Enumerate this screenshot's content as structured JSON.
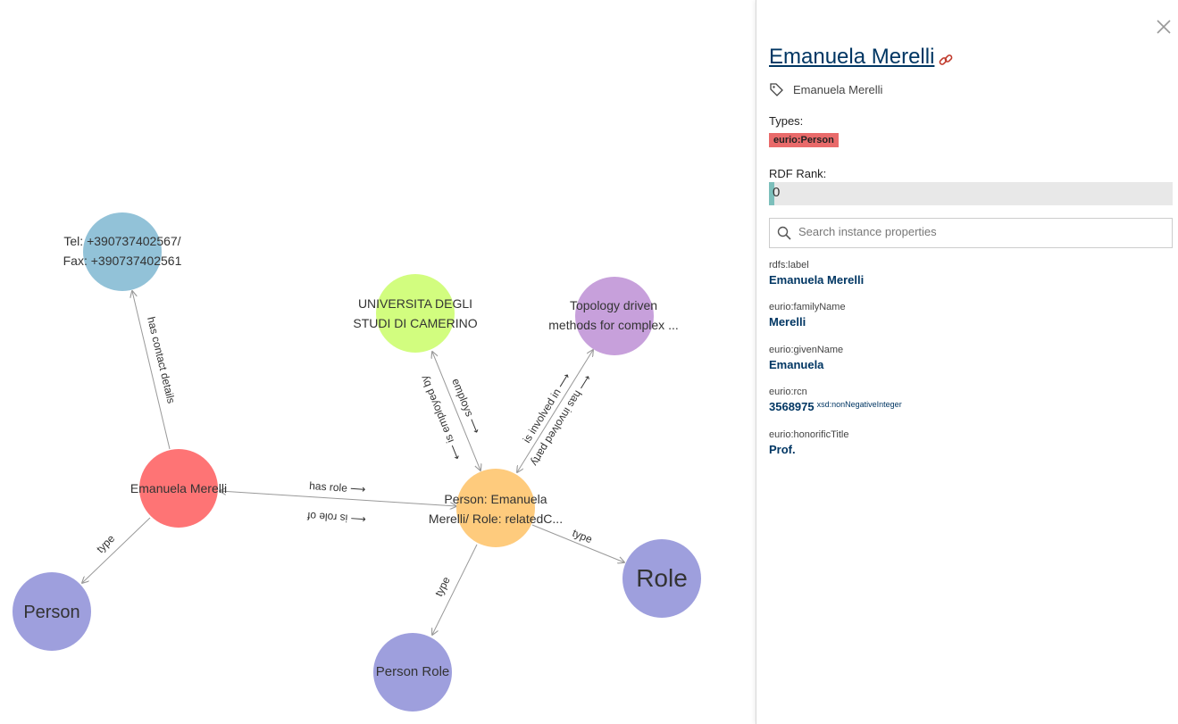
{
  "graph": {
    "nodes": {
      "contact": [
        "Tel: +390737402567/",
        "Fax: +390737402561"
      ],
      "university": [
        "UNIVERSITA DEGLI",
        "STUDI DI CAMERINO"
      ],
      "project": [
        "Topology driven",
        "methods for complex ..."
      ],
      "merelli": "Emanuela Merelli",
      "person_role_node": [
        "Person: Emanuela",
        "Merelli/ Role: relatedC..."
      ],
      "person_class": "Person",
      "person_role_class": "Person Role",
      "role_class": "Role"
    },
    "edges": {
      "has_contact_details": "has contact details",
      "employs": "employs ⟶",
      "is_employed_by": "⟵ is employed by",
      "is_involved_in": "is involved in ⟶",
      "has_involved_party": "⟵ has involved party",
      "has_role": "has role ⟶",
      "is_role_of": "⟵ is role of",
      "type": "type"
    },
    "colors": {
      "contact": "#92c2d8",
      "university": "#d2fd7f",
      "project": "#c7a0db",
      "merelli": "#fe7475",
      "person_role_node": "#fecb7d",
      "class": "#9e9fdd"
    }
  },
  "panel": {
    "collapse_glyph": "‹",
    "title": "Emanuela Merelli",
    "label": "Emanuela Merelli",
    "types_title": "Types:",
    "type_badge": "eurio:Person",
    "rank_title": "RDF Rank:",
    "rank_value": "0",
    "search_placeholder": "Search instance properties",
    "properties": [
      {
        "name": "rdfs:label",
        "value": "Emanuela Merelli",
        "datatype": ""
      },
      {
        "name": "eurio:familyName",
        "value": "Merelli",
        "datatype": ""
      },
      {
        "name": "eurio:givenName",
        "value": "Emanuela",
        "datatype": ""
      },
      {
        "name": "eurio:rcn",
        "value": "3568975",
        "datatype": "xsd:nonNegativeInteger"
      },
      {
        "name": "eurio:honorificTitle",
        "value": "Prof.",
        "datatype": ""
      }
    ]
  }
}
